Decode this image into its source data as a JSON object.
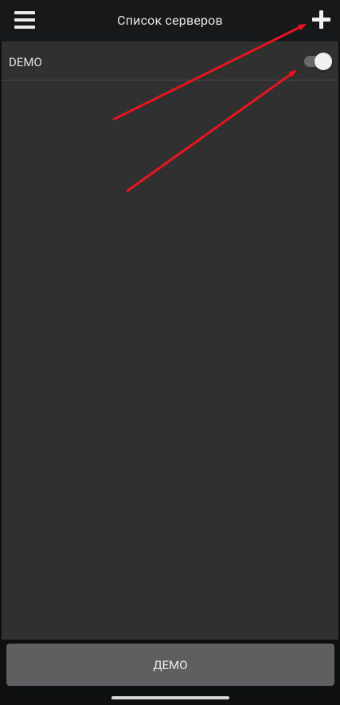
{
  "header": {
    "title": "Список серверов",
    "menu_icon": "hamburger-icon",
    "add_icon": "plus-icon"
  },
  "servers": [
    {
      "label": "DEMO",
      "enabled": true
    }
  ],
  "footer": {
    "button_label": "ДЕМО"
  },
  "colors": {
    "topbar_bg": "#16181a",
    "content_bg": "#303030",
    "button_bg": "#5f5f62",
    "annotation_arrow": "#e8141e"
  }
}
